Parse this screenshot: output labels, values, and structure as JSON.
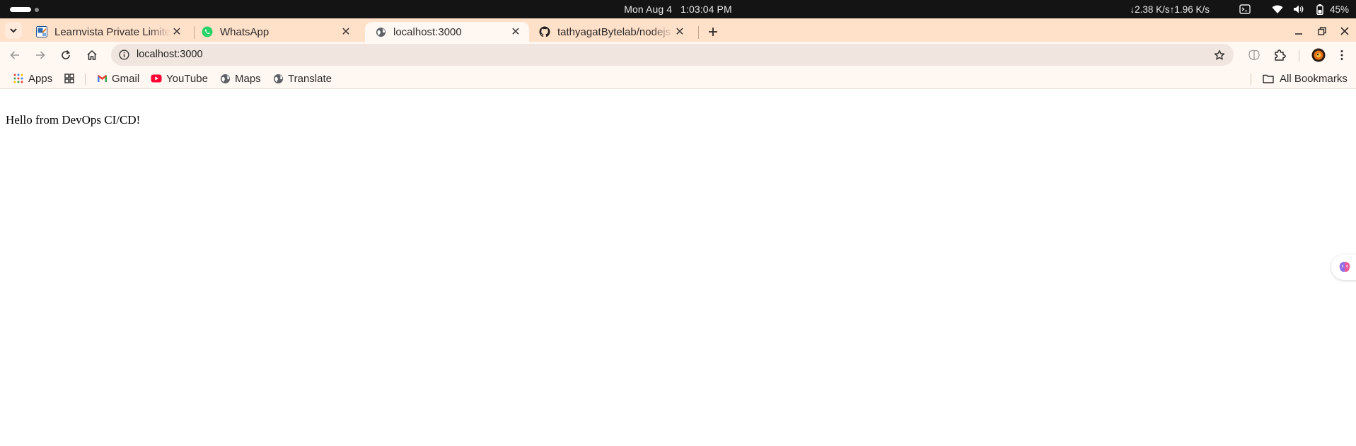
{
  "os_bar": {
    "date": "Mon Aug 4",
    "time": "1:03:04 PM",
    "network_speed": "↓2.38 K/s↑1.96 K/s",
    "battery": "45%"
  },
  "tabs": [
    {
      "title": "Learnvista Private Limite",
      "icon": "learnvista-favicon",
      "active": false
    },
    {
      "title": "WhatsApp",
      "icon": "whatsapp-icon",
      "active": false
    },
    {
      "title": "localhost:3000",
      "icon": "globe-icon",
      "active": true
    },
    {
      "title": "tathyagatBytelab/nodejs",
      "icon": "github-icon",
      "active": false
    }
  ],
  "omnibox": {
    "url": "localhost:3000"
  },
  "bookmarks": {
    "items": [
      {
        "label": "Apps",
        "icon": "apps-grid-icon"
      },
      {
        "label": "Gmail",
        "icon": "gmail-icon"
      },
      {
        "label": "YouTube",
        "icon": "youtube-icon"
      },
      {
        "label": "Maps",
        "icon": "globe-icon"
      },
      {
        "label": "Translate",
        "icon": "globe-icon"
      }
    ],
    "all_bookmarks": "All Bookmarks"
  },
  "page": {
    "message": "Hello from DevOps CI/CD!"
  },
  "colors": {
    "tabstrip_bg": "#ffe0c9",
    "toolbar_bg": "#fff8f2",
    "omnibox_bg": "#f1e6df",
    "os_bar_bg": "#141414"
  }
}
